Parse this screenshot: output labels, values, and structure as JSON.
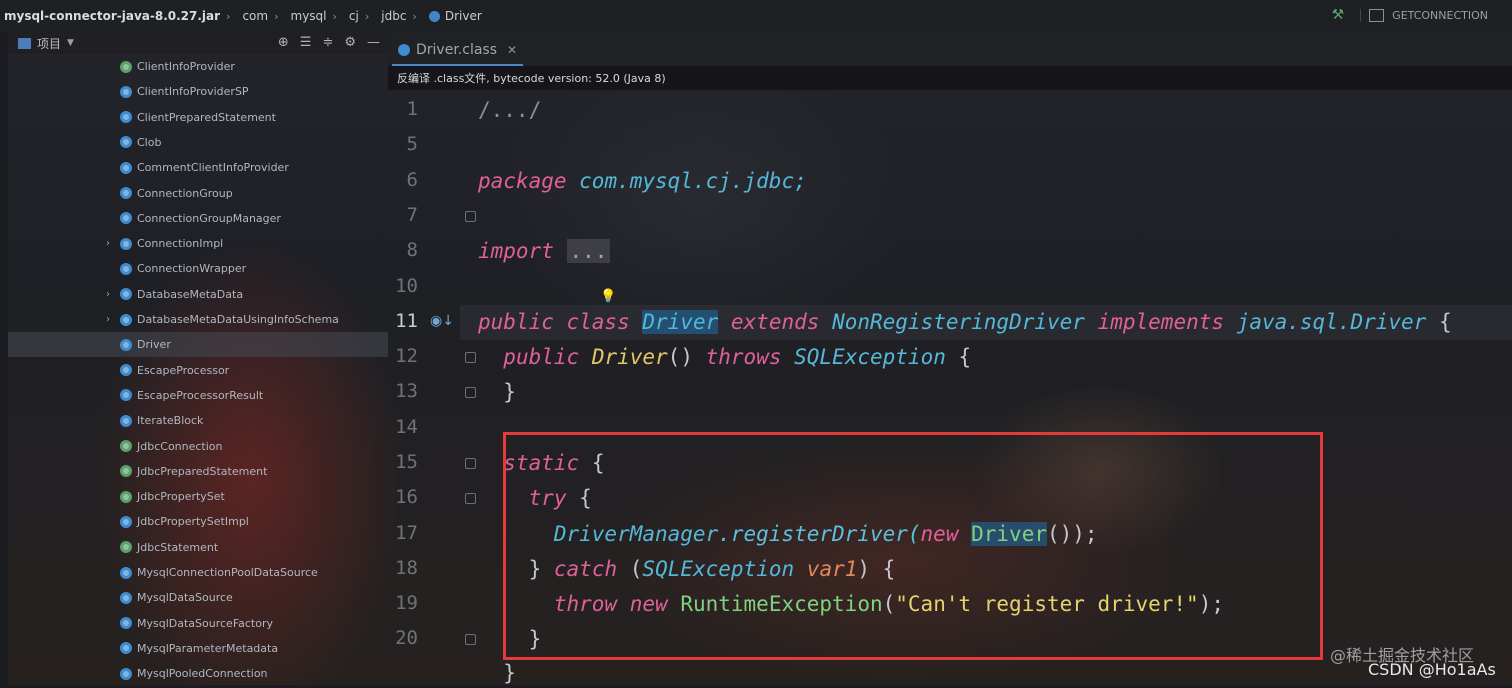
{
  "breadcrumb": {
    "jar": "mysql-connector-java-8.0.27.jar",
    "parts": [
      "com",
      "mysql",
      "cj",
      "jdbc"
    ],
    "current": "Driver"
  },
  "toolbar": {
    "run_config": "GETCONNECTION"
  },
  "project_panel": {
    "title": "项目",
    "items": [
      {
        "label": "ClientInfoProvider",
        "kind": "interface",
        "expandable": false
      },
      {
        "label": "ClientInfoProviderSP",
        "kind": "class",
        "expandable": false
      },
      {
        "label": "ClientPreparedStatement",
        "kind": "class",
        "expandable": false
      },
      {
        "label": "Clob",
        "kind": "class",
        "expandable": false
      },
      {
        "label": "CommentClientInfoProvider",
        "kind": "class",
        "expandable": false
      },
      {
        "label": "ConnectionGroup",
        "kind": "class",
        "expandable": false
      },
      {
        "label": "ConnectionGroupManager",
        "kind": "class",
        "expandable": false
      },
      {
        "label": "ConnectionImpl",
        "kind": "class",
        "expandable": true
      },
      {
        "label": "ConnectionWrapper",
        "kind": "class",
        "expandable": false
      },
      {
        "label": "DatabaseMetaData",
        "kind": "class",
        "expandable": true
      },
      {
        "label": "DatabaseMetaDataUsingInfoSchema",
        "kind": "class",
        "expandable": true
      },
      {
        "label": "Driver",
        "kind": "class",
        "expandable": false,
        "selected": true
      },
      {
        "label": "EscapeProcessor",
        "kind": "class",
        "expandable": false
      },
      {
        "label": "EscapeProcessorResult",
        "kind": "class",
        "expandable": false
      },
      {
        "label": "IterateBlock",
        "kind": "class",
        "expandable": false
      },
      {
        "label": "JdbcConnection",
        "kind": "interface",
        "expandable": false
      },
      {
        "label": "JdbcPreparedStatement",
        "kind": "interface",
        "expandable": false
      },
      {
        "label": "JdbcPropertySet",
        "kind": "interface",
        "expandable": false
      },
      {
        "label": "JdbcPropertySetImpl",
        "kind": "class",
        "expandable": false
      },
      {
        "label": "JdbcStatement",
        "kind": "interface",
        "expandable": false
      },
      {
        "label": "MysqlConnectionPoolDataSource",
        "kind": "class",
        "expandable": false
      },
      {
        "label": "MysqlDataSource",
        "kind": "class",
        "expandable": false
      },
      {
        "label": "MysqlDataSourceFactory",
        "kind": "class",
        "expandable": false
      },
      {
        "label": "MysqlParameterMetadata",
        "kind": "class",
        "expandable": false
      },
      {
        "label": "MysqlPooledConnection",
        "kind": "class",
        "expandable": false
      }
    ]
  },
  "editor": {
    "tab_label": "Driver.class",
    "decompile_notice": "反编译 .class文件, bytecode version: 52.0 (Java 8)",
    "line_numbers": [
      "1",
      "5",
      "6",
      "7",
      "8",
      "10",
      "11",
      "12",
      "13",
      "14",
      "15",
      "16",
      "17",
      "18",
      "19",
      "20"
    ],
    "code": {
      "l1": "/.../",
      "l6_kw": "package",
      "l6_rest": " com.mysql.cj.jdbc;",
      "l8_kw": "import",
      "l8_fold": "...",
      "l11_a": "public class",
      "l11_b": "Driver",
      "l11_c": "extends",
      "l11_d": "NonRegisteringDriver",
      "l11_e": "implements",
      "l11_f": "java.sql.Driver",
      "l11_g": "{",
      "l12_a": "public",
      "l12_b": "Driver",
      "l12_c": "()",
      "l12_d": "throws",
      "l12_e": "SQLException",
      "l12_f": "{",
      "l13": "}",
      "l15_a": "static",
      "l15_b": "{",
      "l16_a": "try",
      "l16_b": "{",
      "l17_a": "DriverManager",
      "l17_b": ".registerDriver(",
      "l17_c": "new",
      "l17_d": "Driver",
      "l17_e": "());",
      "l18_a": "}",
      "l18_b": "catch",
      "l18_c": "(",
      "l18_d": "SQLException",
      "l18_e": "var1",
      "l18_f": ") {",
      "l19_a": "throw new",
      "l19_b": "RuntimeException",
      "l19_c": "(",
      "l19_d": "\"Can't register driver!\"",
      "l19_e": ");",
      "l20": "}",
      "l21": "}"
    }
  },
  "watermark": {
    "line1": "@稀土掘金技术社区",
    "line2": "CSDN @Ho1aAs"
  }
}
